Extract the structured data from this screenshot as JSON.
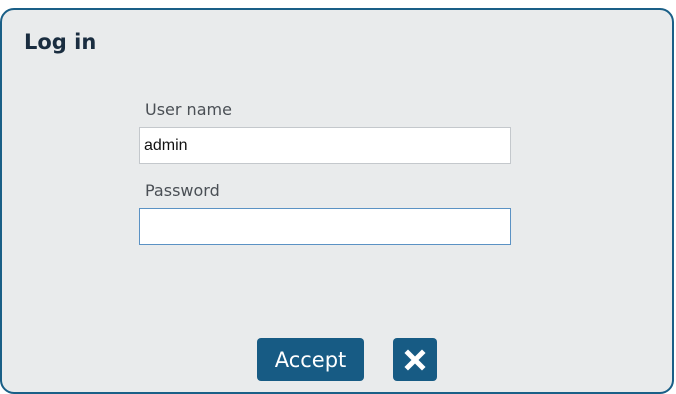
{
  "dialog": {
    "title": "Log in",
    "username": {
      "label": "User name",
      "value": "admin",
      "placeholder": ""
    },
    "password": {
      "label": "Password",
      "value": "",
      "placeholder": ""
    },
    "buttons": {
      "accept_label": "Accept",
      "close_icon": "close-icon"
    }
  },
  "colors": {
    "accent": "#175b84",
    "panel_bg": "#e9ebec",
    "title_text": "#1a2d40"
  }
}
